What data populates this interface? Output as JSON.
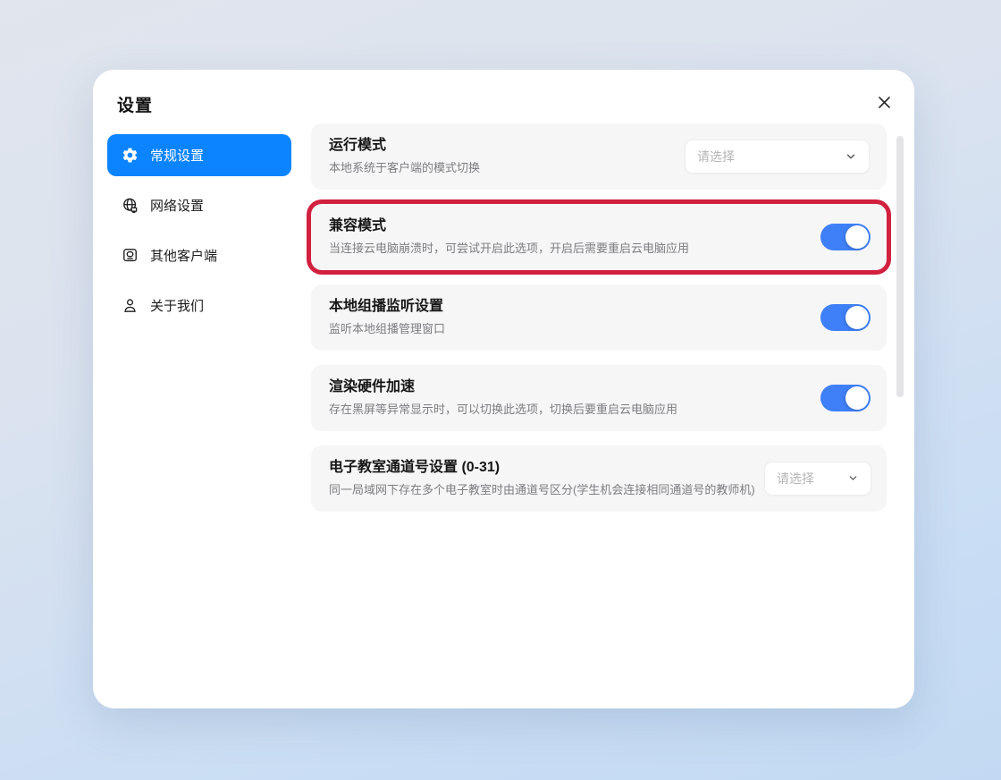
{
  "dialog": {
    "title": "设置"
  },
  "sidebar": {
    "items": [
      {
        "label": "常规设置",
        "icon": "gear-icon",
        "selected": true
      },
      {
        "label": "网络设置",
        "icon": "network-globe-icon",
        "selected": false
      },
      {
        "label": "其他客户端",
        "icon": "other-clients-monitor-icon",
        "selected": false
      },
      {
        "label": "关于我们",
        "icon": "about-person-icon",
        "selected": false
      }
    ]
  },
  "settings": {
    "rows": [
      {
        "title": "运行模式",
        "description": "本地系统于客户端的模式切换",
        "control": "dropdown",
        "placeholder": "请选择"
      },
      {
        "title": "兼容模式",
        "description": "当连接云电脑崩溃时，可尝试开启此选项，开启后需要重启云电脑应用",
        "control": "toggle",
        "state": "on",
        "highlighted": true
      },
      {
        "title": "本地组播监听设置",
        "description": "监听本地组播管理窗口",
        "control": "toggle",
        "state": "on"
      },
      {
        "title": "渲染硬件加速",
        "description": "存在黑屏等异常显示时，可以切换此选项，切换后要重启云电脑应用",
        "control": "toggle",
        "state": "on"
      },
      {
        "title": "电子教室通道号设置 (0-31)",
        "description": "同一局域网下存在多个电子教室时由通道号区分(学生机会连接相同通道号的教师机)",
        "control": "dropdown",
        "placeholder": "请选择"
      }
    ]
  },
  "colors": {
    "accent_blue": "#0d84ff",
    "toggle_blue": "#3f80f8",
    "highlight_red": "#d2203f",
    "card_background": "#f6f6f7"
  }
}
